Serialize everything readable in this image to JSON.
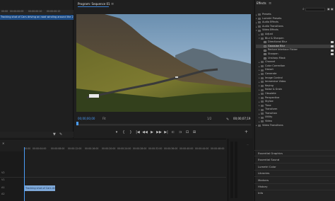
{
  "source": {
    "ruler_ticks": [
      "00:00",
      "00:00:00:05",
      "00:00:00:10",
      "00:00:00:15"
    ],
    "clip_name": "Tracking shot of Cars driving on road winding around the 2023 M..."
  },
  "program": {
    "tab_label": "Program: Sequence 01",
    "timecode_current": "00;00;00;00",
    "zoom": "Fit",
    "fit_label": "1/2",
    "timecode_duration": "00;00;07;19",
    "transport": [
      "▾",
      "{",
      "}",
      "|◀",
      "◀◀",
      "▶",
      "▶▶",
      "▶|",
      "⊏",
      "⊐",
      "⊡",
      "⊞",
      "+"
    ]
  },
  "effects": {
    "tab_label": "Effects",
    "search_placeholder": "",
    "items": [
      {
        "label": "Presets",
        "depth": 0,
        "kind": "folder"
      },
      {
        "label": "Lumetri Presets",
        "depth": 0,
        "kind": "folder"
      },
      {
        "label": "Audio Effects",
        "depth": 0,
        "kind": "folder"
      },
      {
        "label": "Audio Transitions",
        "depth": 0,
        "kind": "folder"
      },
      {
        "label": "Video Effects",
        "depth": 0,
        "kind": "folder"
      },
      {
        "label": "Adjust",
        "depth": 1,
        "kind": "folder"
      },
      {
        "label": "Blur & Sharpen",
        "depth": 1,
        "kind": "folder"
      },
      {
        "label": "Directional Blur",
        "depth": 2,
        "kind": "fx"
      },
      {
        "label": "Gaussian Blur",
        "depth": 2,
        "kind": "fx",
        "selected": true
      },
      {
        "label": "Reduce Interlace Flicker",
        "depth": 2,
        "kind": "fx"
      },
      {
        "label": "Sharpen",
        "depth": 2,
        "kind": "fx"
      },
      {
        "label": "Unsharp Mask",
        "depth": 2,
        "kind": "fx"
      },
      {
        "label": "Channel",
        "depth": 1,
        "kind": "folder"
      },
      {
        "label": "Color Correction",
        "depth": 1,
        "kind": "folder"
      },
      {
        "label": "Distort",
        "depth": 1,
        "kind": "folder"
      },
      {
        "label": "Generate",
        "depth": 1,
        "kind": "folder"
      },
      {
        "label": "Image Control",
        "depth": 1,
        "kind": "folder"
      },
      {
        "label": "Immersive Video",
        "depth": 1,
        "kind": "folder"
      },
      {
        "label": "Keying",
        "depth": 1,
        "kind": "folder"
      },
      {
        "label": "Noise & Grain",
        "depth": 1,
        "kind": "folder"
      },
      {
        "label": "Obsolete",
        "depth": 1,
        "kind": "folder"
      },
      {
        "label": "Perspective",
        "depth": 1,
        "kind": "folder"
      },
      {
        "label": "Stylize",
        "depth": 1,
        "kind": "folder"
      },
      {
        "label": "Time",
        "depth": 1,
        "kind": "folder"
      },
      {
        "label": "Transform",
        "depth": 1,
        "kind": "folder"
      },
      {
        "label": "Transition",
        "depth": 1,
        "kind": "folder"
      },
      {
        "label": "Utility",
        "depth": 1,
        "kind": "folder"
      },
      {
        "label": "Video",
        "depth": 1,
        "kind": "folder"
      },
      {
        "label": "Video Transitions",
        "depth": 0,
        "kind": "folder"
      }
    ]
  },
  "timeline": {
    "ruler_ticks": [
      "00:00",
      "00:00:04:00",
      "00:00:08:00",
      "00:00:12:00",
      "00:00:16:00",
      "00:00:20:00",
      "00:00:24:00",
      "00:00:28:00",
      "00:00:32:00",
      "00:00:36:00",
      "00:00:40:00",
      "00:00:44:00",
      "00:00:48:00"
    ],
    "tracks": [
      "V2",
      "V1",
      "A1",
      "A2"
    ],
    "clip_name": "Tracking shot of Cars driving o..."
  },
  "right_stack": {
    "items": [
      "Essential Graphics",
      "Essential Sound",
      "Lumetri Color",
      "Libraries",
      "Markers",
      "History",
      "Info"
    ]
  },
  "colors": {
    "accent_blue": "#4a9df8",
    "clip_blue": "#7ea8d8",
    "selected_row": "#3d3d3d"
  }
}
